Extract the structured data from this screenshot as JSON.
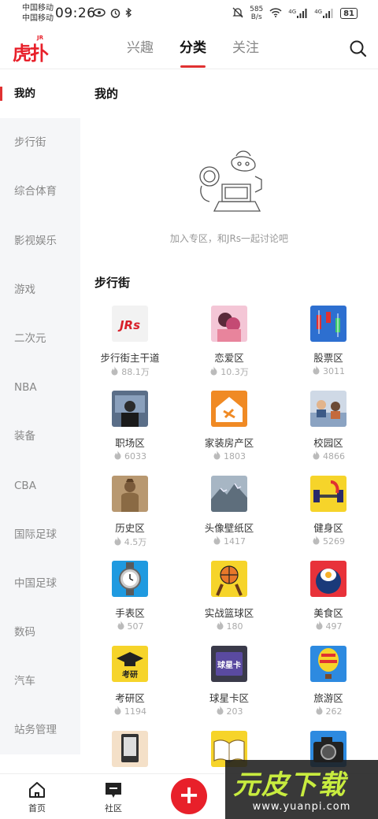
{
  "status_bar": {
    "carrier1": "中国移动",
    "carrier2": "中国移动",
    "time": "09:26",
    "speed_value": "585",
    "speed_unit": "B/s",
    "signal1_label": "4G",
    "signal2_label": "4G",
    "battery": "81"
  },
  "header": {
    "logo_text": "虎扑",
    "logo_badge": "JR",
    "tabs": [
      {
        "label": "兴趣"
      },
      {
        "label": "分类"
      },
      {
        "label": "关注"
      }
    ]
  },
  "sidebar": {
    "items": [
      {
        "label": "我的"
      },
      {
        "label": "步行街"
      },
      {
        "label": "综合体育"
      },
      {
        "label": "影视娱乐"
      },
      {
        "label": "游戏"
      },
      {
        "label": "二次元"
      },
      {
        "label": "NBA"
      },
      {
        "label": "装备"
      },
      {
        "label": "CBA"
      },
      {
        "label": "国际足球"
      },
      {
        "label": "中国足球"
      },
      {
        "label": "数码"
      },
      {
        "label": "汽车"
      },
      {
        "label": "站务管理"
      }
    ]
  },
  "mine": {
    "title": "我的",
    "empty_text": "加入专区，和JRs一起讨论吧"
  },
  "bxj": {
    "title": "步行街",
    "items": [
      {
        "name": "步行街主干道",
        "count": "88.1万",
        "thumb_text": "JRs"
      },
      {
        "name": "恋爱区",
        "count": "10.3万"
      },
      {
        "name": "股票区",
        "count": "3011"
      },
      {
        "name": "职场区",
        "count": "6033"
      },
      {
        "name": "家装房产区",
        "count": "1803"
      },
      {
        "name": "校园区",
        "count": "4866"
      },
      {
        "name": "历史区",
        "count": "4.5万"
      },
      {
        "name": "头像壁纸区",
        "count": "1417"
      },
      {
        "name": "健身区",
        "count": "5269"
      },
      {
        "name": "手表区",
        "count": "507"
      },
      {
        "name": "实战篮球区",
        "count": "180"
      },
      {
        "name": "美食区",
        "count": "497"
      },
      {
        "name": "考研区",
        "count": "1194",
        "thumb_text": "考研"
      },
      {
        "name": "球星卡区",
        "count": "203",
        "thumb_text": "球星卡"
      },
      {
        "name": "旅游区",
        "count": "262"
      }
    ]
  },
  "bottom_nav": {
    "home": "首页",
    "community": "社区",
    "fab": "+"
  },
  "watermark": {
    "title": "元皮下载",
    "url": "www.yuanpi.com"
  }
}
